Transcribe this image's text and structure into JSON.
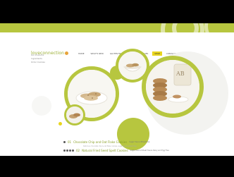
{
  "brand": {
    "logo_text": "loveconnection",
    "accent_green": "#b7c63f",
    "accent_yellow": "#e9d51e"
  },
  "nav": {
    "items": [
      {
        "label": "HOME",
        "active": false
      },
      {
        "label": "WHAT'S NEW",
        "active": false
      },
      {
        "label": "GLUTEN FREE & SUGAR FREE COOKIES",
        "active": false
      },
      {
        "label": "SHOP",
        "active": true
      },
      {
        "label": "CONTACT US",
        "active": false
      },
      {
        "label": "ACCOUNT",
        "active": false
      }
    ]
  },
  "sidebar": {
    "links": [
      "Our Products",
      "Ingredients",
      "Order Cookies"
    ]
  },
  "photo_text": {
    "jar_label": "AB"
  },
  "products": [
    {
      "number": "01",
      "title": "Chocolate Chip and Oat Flake Cookies",
      "subtitle": "Sugar free & Wheat free",
      "description": "Delicious chocolate chip & oat flake cookies, sugar free & wheat free."
    },
    {
      "number": "02",
      "title": "Natural Fried Seed Spelt Cookies",
      "subtitle": "Sugar free & Wheat free & Dairy and Egg Free",
      "description": ""
    }
  ]
}
